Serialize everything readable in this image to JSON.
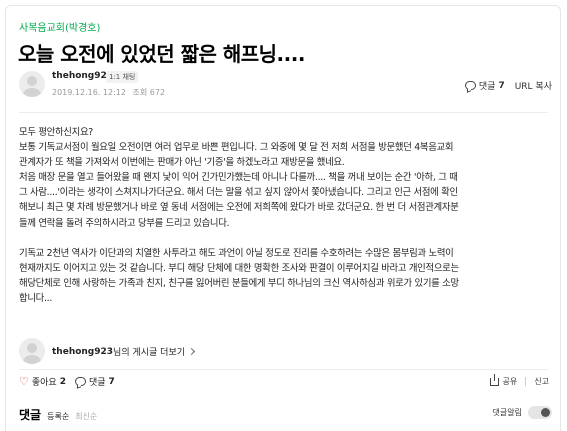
{
  "cafe": {
    "link_label": "사복음교회(박경호)"
  },
  "post": {
    "title": "오늘 오전에 있었던 짧은 해프닝....",
    "author": "thehong923",
    "chat_badge": "1:1 채팅",
    "date": "2019.12.16. 12:12",
    "views": "조회 672",
    "comment_label": "댓글",
    "comment_count": "7",
    "url_copy": "URL 복사"
  },
  "body": {
    "lines_1": [
      "모두 평안하신지요?",
      "보통 기독교서점이 월요일 오전이면 여러 업무로 바쁜 편입니다. 그 와중에 몇 달 전 저희 서점을 방문했던 4복음교회",
      "관계자가 또 책을 가져와서 이번에는 판매가 아닌 '기증'을 하겠노라고 재방문을 했네요.",
      "처음 매장 문을 열고 들어왔을 때 왠지 낯이 익어 긴가민가했는데 아니나 다를까.... 책을 꺼내 보이는 순간 '아하, 그 때",
      "그 사람....'이라는 생각이 스쳐지나가더군요. 해서 더는 말을 섞고 싶지 않아서 쫓아냈습니다. 그리고 인근 서점에 확인",
      "해보니 최근 몇 차례 방문했거나 바로 옆 동네 서점에는 오전에 저희쪽에 왔다가 바로 갔더군요. 한 번 더 서점관계자분",
      "들께 연락을 돌려 주의하시라고 당부를 드리고 있습니다."
    ],
    "lines_2": [
      "기독교 2천년 역사가 이단과의 치열한 사투라고 해도 과언이 아닐 정도로 진리를 수호하려는 수많은 몸부림과 노력이",
      "현재까지도 이어지고 있는 것 같습니다. 부디 해당 단체에 대한 명확한 조사와 판결이 이루어지길 바라고 개인적으로는",
      "해당단체로 인해 사랑하는 가족과 친지, 친구를 잃어버린 분들에게 부디 하나님의 크신 역사하심과 위로가 있기를 소망",
      "합니다..."
    ]
  },
  "profile_link": {
    "name": "thehong923",
    "suffix": "님의 게시글 더보기"
  },
  "reactions": {
    "like_label": "좋아요",
    "like_count": "2",
    "comment_label": "댓글",
    "comment_count": "7",
    "share_label": "공유",
    "report_label": "신고"
  },
  "comments_section": {
    "title": "댓글",
    "sort_registered": "등록순",
    "sort_latest": "최신순",
    "notify_label": "댓글알림",
    "notify_on": false
  },
  "colors": {
    "accent_green": "#03a94d",
    "heart_red": "#e04040"
  }
}
